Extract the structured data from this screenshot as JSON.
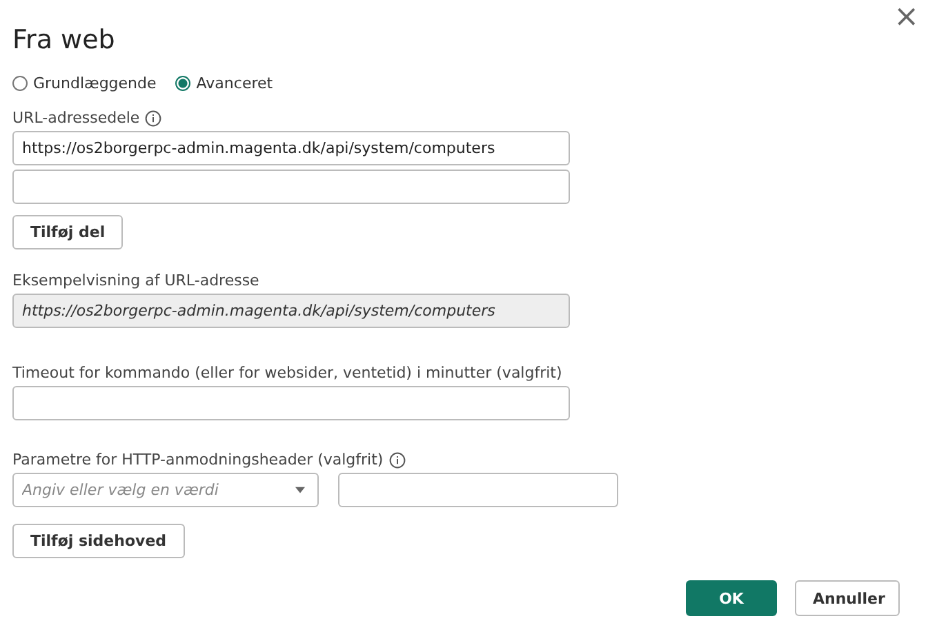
{
  "dialog": {
    "title": "Fra web",
    "close": "×"
  },
  "mode": [
    {
      "label": "Grundlæggende",
      "selected": false
    },
    {
      "label": "Avanceret",
      "selected": true
    }
  ],
  "url_parts": {
    "label": "URL-adressedele",
    "value": "https://os2borgerpc-admin.magenta.dk/api/system/computers",
    "add_button": "Tilføj del"
  },
  "preview": {
    "label": "Eksempelvisning af URL-adresse",
    "value": "https://os2borgerpc-admin.magenta.dk/api/system/computers"
  },
  "timeout": {
    "label": "Timeout for kommando (eller for websider, ventetid) i minutter (valgfrit)"
  },
  "headers": {
    "label": "Parametre for HTTP-anmodningsheader (valgfrit)",
    "dropdown_placeholder": "Angiv eller vælg en værdi",
    "add_button": "Tilføj sidehoved"
  },
  "buttons": {
    "ok": "OK",
    "cancel": "Annuller"
  }
}
